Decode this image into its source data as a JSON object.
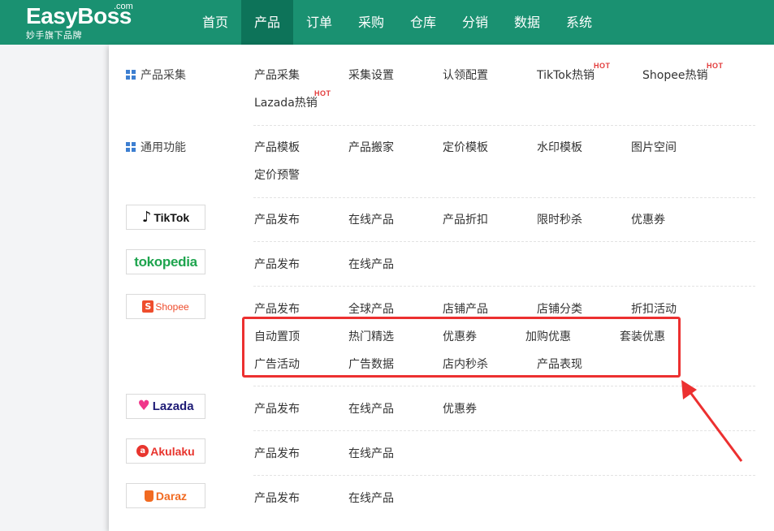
{
  "brand": {
    "name": "EasyBoss",
    "com": ".com",
    "subtitle": "妙手旗下品牌"
  },
  "nav": [
    "首页",
    "产品",
    "订单",
    "采购",
    "仓库",
    "分销",
    "数据",
    "系统"
  ],
  "hot_badge": "HOT",
  "sections": {
    "collect": {
      "title": "产品采集",
      "links": [
        "产品采集",
        "采集设置",
        "认领配置",
        "TikTok热销",
        "Shopee热销",
        "Lazada热销"
      ]
    },
    "common": {
      "title": "通用功能",
      "links": [
        "产品模板",
        "产品搬家",
        "定价模板",
        "水印模板",
        "图片空间",
        "定价预警"
      ]
    },
    "tiktok": {
      "logo": "TikTok",
      "links": [
        "产品发布",
        "在线产品",
        "产品折扣",
        "限时秒杀",
        "优惠券"
      ]
    },
    "tokopedia": {
      "logo": "tokopedia",
      "links": [
        "产品发布",
        "在线产品"
      ]
    },
    "shopee": {
      "logo": "Shopee",
      "links": [
        "产品发布",
        "全球产品",
        "店铺产品",
        "店铺分类",
        "折扣活动",
        "自动置顶",
        "热门精选",
        "优惠券",
        "加购优惠",
        "套装优惠",
        "广告活动",
        "广告数据",
        "店内秒杀",
        "产品表现"
      ]
    },
    "lazada": {
      "logo": "Lazada",
      "links": [
        "产品发布",
        "在线产品",
        "优惠券"
      ]
    },
    "akulaku": {
      "logo": "Akulaku",
      "links": [
        "产品发布",
        "在线产品"
      ]
    },
    "daraz": {
      "logo": "Daraz",
      "links": [
        "产品发布",
        "在线产品"
      ]
    }
  },
  "colors": {
    "header": "#1a9171",
    "header_active": "#0d7359",
    "highlight": "#ec3030",
    "hot": "#e23a3a",
    "tokopedia": "#1ea44e",
    "shopee": "#ee4d2d",
    "lazada": "#1e1b76",
    "akulaku": "#e8352e",
    "daraz": "#f16a21"
  }
}
